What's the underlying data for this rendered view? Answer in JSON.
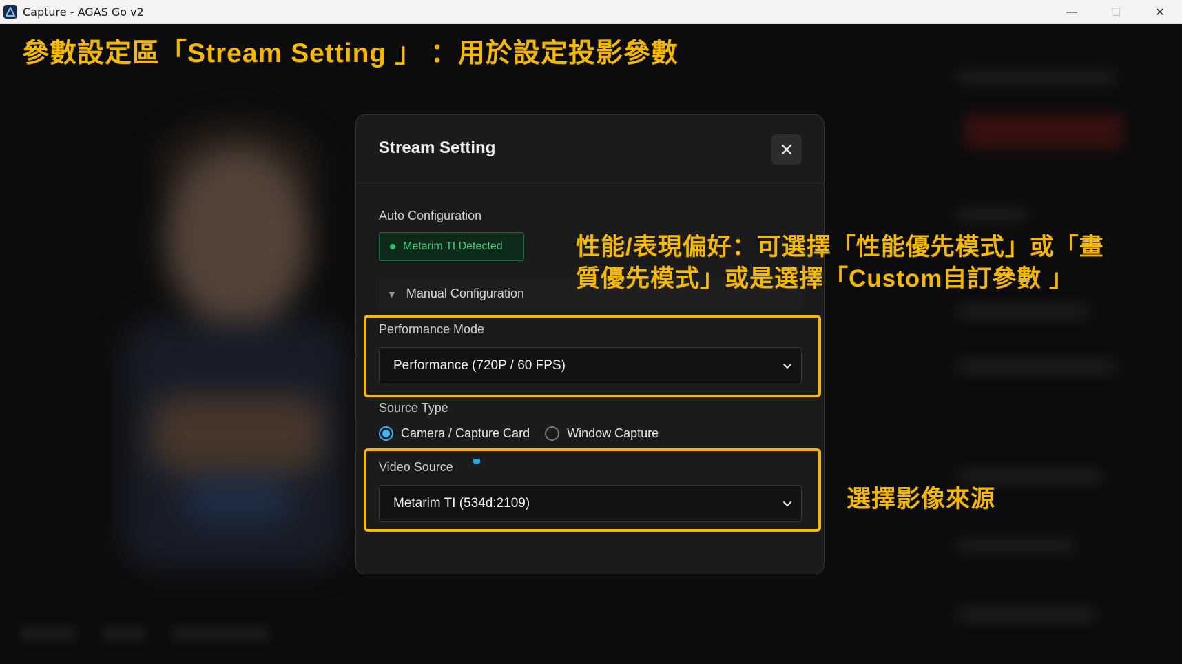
{
  "window": {
    "title": "Capture - AGAS Go v2",
    "controls": {
      "minimize": "—",
      "maximize": "☐",
      "close": "✕"
    }
  },
  "annotations": {
    "top": "參數設定區「Stream Setting 」 ：用於設定投影參數",
    "performance_line1": "性能/表現偏好：可選擇「性能優先模式」或「畫",
    "performance_line2": "質優先模式」或是選擇「Custom自訂參數 」",
    "video_source": "選擇影像來源",
    "highlight_color": "#f5b800"
  },
  "modal": {
    "title": "Stream Setting",
    "close_icon": "close-icon",
    "auto_config_label": "Auto Configuration",
    "detected_badge": "Metarim TI Detected",
    "manual_config_toggle": "▼",
    "manual_config_label": "Manual Configuration",
    "performance_mode_label": "Performance Mode",
    "performance_mode_value": "Performance (720P / 60 FPS)",
    "source_type_label": "Source Type",
    "source_types": [
      {
        "label": "Camera / Capture Card",
        "selected": true
      },
      {
        "label": "Window Capture",
        "selected": false
      }
    ],
    "video_source_label": "Video Source",
    "video_source_value": "Metarim TI (534d:2109)"
  },
  "colors": {
    "accent": "#3db8ff",
    "success": "#28c76f",
    "annotation": "#f5b800"
  }
}
